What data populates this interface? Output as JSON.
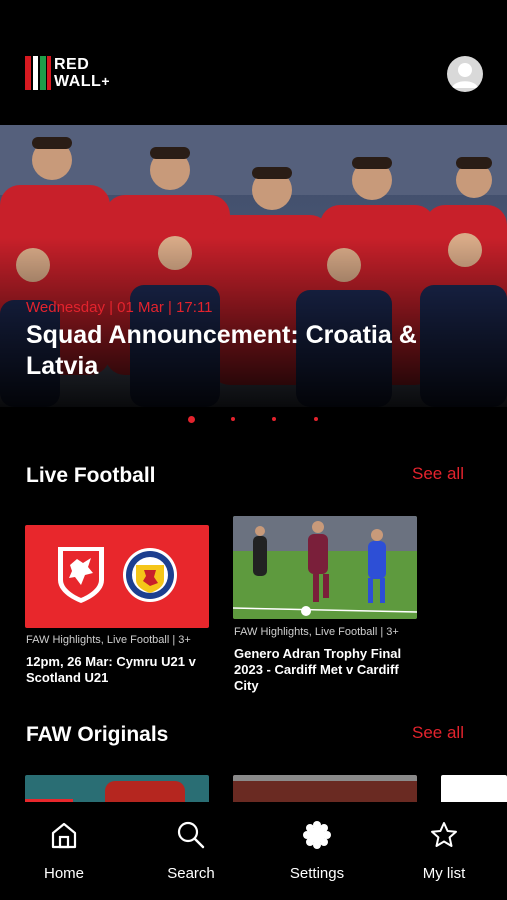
{
  "app": {
    "logo_line1": "RED",
    "logo_line2": "WALL",
    "logo_plus": "+"
  },
  "hero": {
    "date": "Wednesday | 01 Mar | 17:11",
    "title": "Squad Announcement: Croatia & Latvia",
    "carousel_count": 5,
    "carousel_active": 1
  },
  "live_football": {
    "title": "Live Football",
    "see_all": "See all",
    "cards": [
      {
        "meta": "FAW Highlights, Live Football | 3+",
        "title": "12pm, 26 Mar: Cymru U21 v Scotland U21"
      },
      {
        "meta": "FAW Highlights, Live Football | 3+",
        "title": "Genero Adran Trophy Final 2023 - Cardiff Met v Cardiff City"
      }
    ]
  },
  "faw_originals": {
    "title": "FAW Originals",
    "see_all": "See all"
  },
  "tabbar": {
    "items": [
      {
        "label": "Home",
        "icon": "home-icon"
      },
      {
        "label": "Search",
        "icon": "search-icon"
      },
      {
        "label": "Settings",
        "icon": "gear-icon"
      },
      {
        "label": "My list",
        "icon": "star-icon"
      }
    ]
  },
  "colors": {
    "accent": "#e3232d",
    "background": "#000000",
    "card_red": "#e8272c"
  }
}
